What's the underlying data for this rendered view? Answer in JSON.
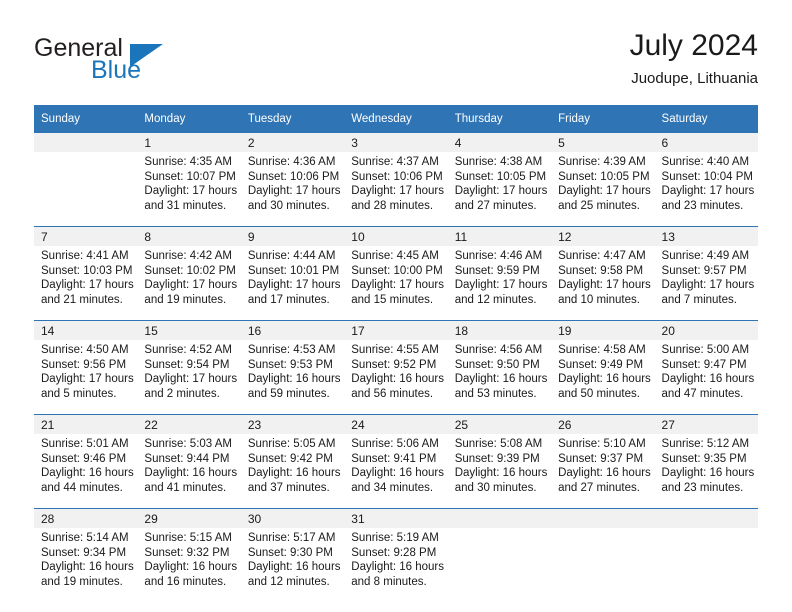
{
  "brand": {
    "name_top": "General",
    "name_bottom": "Blue",
    "accent_color": "#1b75bb"
  },
  "header": {
    "title": "July 2024",
    "subtitle": "Juodupe, Lithuania"
  },
  "theme": {
    "header_blue": "#2f74b5",
    "daynum_band": "#f1f1f1",
    "text": "#1a1a1a"
  },
  "weekdays": [
    "Sunday",
    "Monday",
    "Tuesday",
    "Wednesday",
    "Thursday",
    "Friday",
    "Saturday"
  ],
  "weeks": [
    {
      "days": [
        {
          "num": "",
          "lines": []
        },
        {
          "num": "1",
          "lines": [
            "Sunrise: 4:35 AM",
            "Sunset: 10:07 PM",
            "Daylight: 17 hours",
            "and 31 minutes."
          ]
        },
        {
          "num": "2",
          "lines": [
            "Sunrise: 4:36 AM",
            "Sunset: 10:06 PM",
            "Daylight: 17 hours",
            "and 30 minutes."
          ]
        },
        {
          "num": "3",
          "lines": [
            "Sunrise: 4:37 AM",
            "Sunset: 10:06 PM",
            "Daylight: 17 hours",
            "and 28 minutes."
          ]
        },
        {
          "num": "4",
          "lines": [
            "Sunrise: 4:38 AM",
            "Sunset: 10:05 PM",
            "Daylight: 17 hours",
            "and 27 minutes."
          ]
        },
        {
          "num": "5",
          "lines": [
            "Sunrise: 4:39 AM",
            "Sunset: 10:05 PM",
            "Daylight: 17 hours",
            "and 25 minutes."
          ]
        },
        {
          "num": "6",
          "lines": [
            "Sunrise: 4:40 AM",
            "Sunset: 10:04 PM",
            "Daylight: 17 hours",
            "and 23 minutes."
          ]
        }
      ]
    },
    {
      "days": [
        {
          "num": "7",
          "lines": [
            "Sunrise: 4:41 AM",
            "Sunset: 10:03 PM",
            "Daylight: 17 hours",
            "and 21 minutes."
          ]
        },
        {
          "num": "8",
          "lines": [
            "Sunrise: 4:42 AM",
            "Sunset: 10:02 PM",
            "Daylight: 17 hours",
            "and 19 minutes."
          ]
        },
        {
          "num": "9",
          "lines": [
            "Sunrise: 4:44 AM",
            "Sunset: 10:01 PM",
            "Daylight: 17 hours",
            "and 17 minutes."
          ]
        },
        {
          "num": "10",
          "lines": [
            "Sunrise: 4:45 AM",
            "Sunset: 10:00 PM",
            "Daylight: 17 hours",
            "and 15 minutes."
          ]
        },
        {
          "num": "11",
          "lines": [
            "Sunrise: 4:46 AM",
            "Sunset: 9:59 PM",
            "Daylight: 17 hours",
            "and 12 minutes."
          ]
        },
        {
          "num": "12",
          "lines": [
            "Sunrise: 4:47 AM",
            "Sunset: 9:58 PM",
            "Daylight: 17 hours",
            "and 10 minutes."
          ]
        },
        {
          "num": "13",
          "lines": [
            "Sunrise: 4:49 AM",
            "Sunset: 9:57 PM",
            "Daylight: 17 hours",
            "and 7 minutes."
          ]
        }
      ]
    },
    {
      "days": [
        {
          "num": "14",
          "lines": [
            "Sunrise: 4:50 AM",
            "Sunset: 9:56 PM",
            "Daylight: 17 hours",
            "and 5 minutes."
          ]
        },
        {
          "num": "15",
          "lines": [
            "Sunrise: 4:52 AM",
            "Sunset: 9:54 PM",
            "Daylight: 17 hours",
            "and 2 minutes."
          ]
        },
        {
          "num": "16",
          "lines": [
            "Sunrise: 4:53 AM",
            "Sunset: 9:53 PM",
            "Daylight: 16 hours",
            "and 59 minutes."
          ]
        },
        {
          "num": "17",
          "lines": [
            "Sunrise: 4:55 AM",
            "Sunset: 9:52 PM",
            "Daylight: 16 hours",
            "and 56 minutes."
          ]
        },
        {
          "num": "18",
          "lines": [
            "Sunrise: 4:56 AM",
            "Sunset: 9:50 PM",
            "Daylight: 16 hours",
            "and 53 minutes."
          ]
        },
        {
          "num": "19",
          "lines": [
            "Sunrise: 4:58 AM",
            "Sunset: 9:49 PM",
            "Daylight: 16 hours",
            "and 50 minutes."
          ]
        },
        {
          "num": "20",
          "lines": [
            "Sunrise: 5:00 AM",
            "Sunset: 9:47 PM",
            "Daylight: 16 hours",
            "and 47 minutes."
          ]
        }
      ]
    },
    {
      "days": [
        {
          "num": "21",
          "lines": [
            "Sunrise: 5:01 AM",
            "Sunset: 9:46 PM",
            "Daylight: 16 hours",
            "and 44 minutes."
          ]
        },
        {
          "num": "22",
          "lines": [
            "Sunrise: 5:03 AM",
            "Sunset: 9:44 PM",
            "Daylight: 16 hours",
            "and 41 minutes."
          ]
        },
        {
          "num": "23",
          "lines": [
            "Sunrise: 5:05 AM",
            "Sunset: 9:42 PM",
            "Daylight: 16 hours",
            "and 37 minutes."
          ]
        },
        {
          "num": "24",
          "lines": [
            "Sunrise: 5:06 AM",
            "Sunset: 9:41 PM",
            "Daylight: 16 hours",
            "and 34 minutes."
          ]
        },
        {
          "num": "25",
          "lines": [
            "Sunrise: 5:08 AM",
            "Sunset: 9:39 PM",
            "Daylight: 16 hours",
            "and 30 minutes."
          ]
        },
        {
          "num": "26",
          "lines": [
            "Sunrise: 5:10 AM",
            "Sunset: 9:37 PM",
            "Daylight: 16 hours",
            "and 27 minutes."
          ]
        },
        {
          "num": "27",
          "lines": [
            "Sunrise: 5:12 AM",
            "Sunset: 9:35 PM",
            "Daylight: 16 hours",
            "and 23 minutes."
          ]
        }
      ]
    },
    {
      "days": [
        {
          "num": "28",
          "lines": [
            "Sunrise: 5:14 AM",
            "Sunset: 9:34 PM",
            "Daylight: 16 hours",
            "and 19 minutes."
          ]
        },
        {
          "num": "29",
          "lines": [
            "Sunrise: 5:15 AM",
            "Sunset: 9:32 PM",
            "Daylight: 16 hours",
            "and 16 minutes."
          ]
        },
        {
          "num": "30",
          "lines": [
            "Sunrise: 5:17 AM",
            "Sunset: 9:30 PM",
            "Daylight: 16 hours",
            "and 12 minutes."
          ]
        },
        {
          "num": "31",
          "lines": [
            "Sunrise: 5:19 AM",
            "Sunset: 9:28 PM",
            "Daylight: 16 hours",
            "and 8 minutes."
          ]
        },
        {
          "num": "",
          "lines": []
        },
        {
          "num": "",
          "lines": []
        },
        {
          "num": "",
          "lines": []
        }
      ]
    }
  ]
}
